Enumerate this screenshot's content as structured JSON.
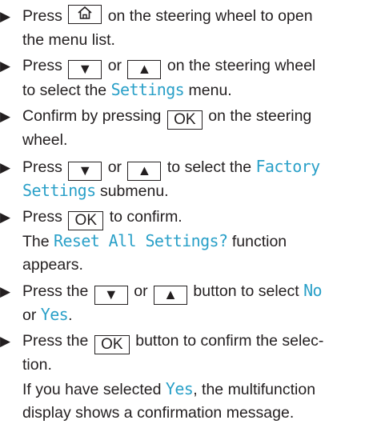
{
  "bullet_glyph": "▶",
  "keys": {
    "home": "home-icon",
    "down": "▼",
    "up": "▲",
    "ok": "OK"
  },
  "steps": [
    {
      "pre": "Press",
      "mid": "on the steering wheel to open",
      "line2": "the menu list."
    },
    {
      "pre": "Press",
      "or": "or",
      "post": "on the steering wheel",
      "line2_pre": "to select the",
      "menu": "Settings",
      "line2_post": "menu."
    },
    {
      "pre": "Confirm by pressing",
      "post": "on the steering",
      "line2": "wheel."
    },
    {
      "pre": "Press",
      "or": "or",
      "post": "to select the",
      "menu1": "Factory",
      "menu2": "Settings",
      "line2_post": "submenu."
    },
    {
      "pre": "Press",
      "post": "to confirm.",
      "result_pre": "The",
      "func": "Reset All Settings?",
      "result_post": "function",
      "result_line2": "appears."
    },
    {
      "pre": "Press the",
      "or": "or",
      "post": "button to select",
      "opt_no": "No",
      "or2": "or",
      "opt_yes": "Yes",
      "end": "."
    },
    {
      "pre": "Press the",
      "post": "button to confirm the selec-",
      "line2": "tion.",
      "result_pre": "If you have selected",
      "opt_yes": "Yes",
      "result_post": ", the multifunction",
      "result_line2": "display shows a confirmation message."
    }
  ],
  "colors": {
    "text": "#231f20",
    "highlight": "#2aa0c8"
  }
}
